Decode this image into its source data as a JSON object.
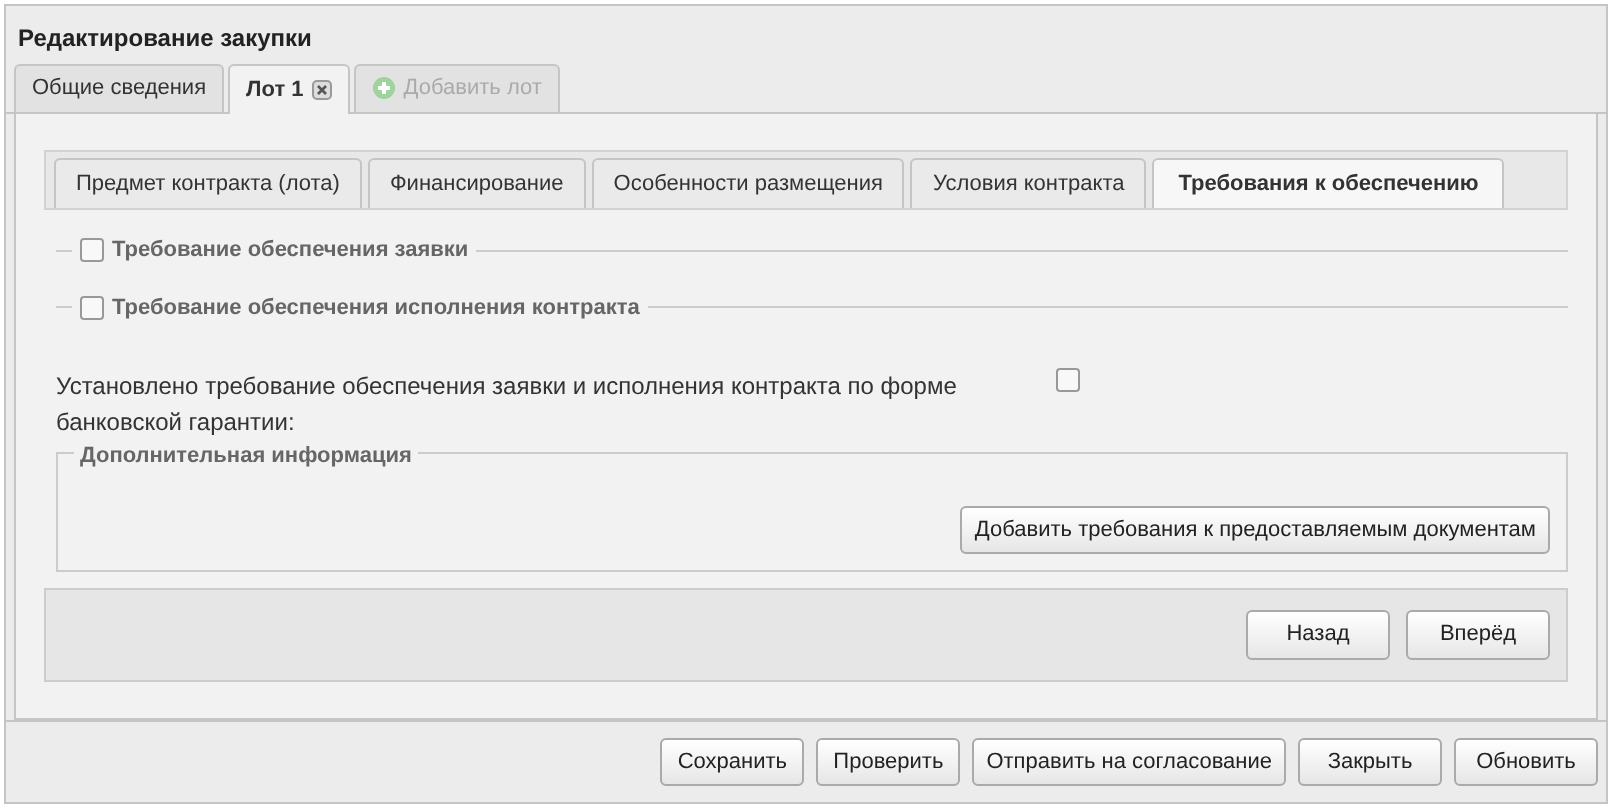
{
  "window": {
    "title": "Редактирование закупки"
  },
  "outer_tabs": [
    {
      "kind": "tab",
      "label": "Общие сведения",
      "selected": false,
      "closable": false
    },
    {
      "kind": "tab",
      "label": "Лот 1",
      "selected": true,
      "closable": true
    },
    {
      "kind": "add",
      "label": "Добавить лот",
      "selected": false,
      "disabled": true
    }
  ],
  "inner_tabs": [
    {
      "label": "Предмет контракта (лота)",
      "selected": false
    },
    {
      "label": "Финансирование",
      "selected": false
    },
    {
      "label": "Особенности размещения",
      "selected": false
    },
    {
      "label": "Условия контракта",
      "selected": false
    },
    {
      "label": "Требования к обеспечению",
      "selected": true
    }
  ],
  "sections": [
    {
      "title": "Требование обеспечения заявки",
      "checked": false
    },
    {
      "title": "Требование обеспечения исполнения контракта",
      "checked": false
    }
  ],
  "bank_guarantee": {
    "label": "Установлено требование обеспечения заявки и исполнения контракта по форме банковской гарантии:",
    "checked": false
  },
  "additional_info": {
    "title": "Дополнительная информация",
    "button": "Добавить требования к предоставляемым документам"
  },
  "nav_buttons": [
    "Назад",
    "Вперёд"
  ],
  "footer_buttons": [
    "Сохранить",
    "Проверить",
    "Отправить на согласование",
    "Закрыть",
    "Обновить"
  ]
}
